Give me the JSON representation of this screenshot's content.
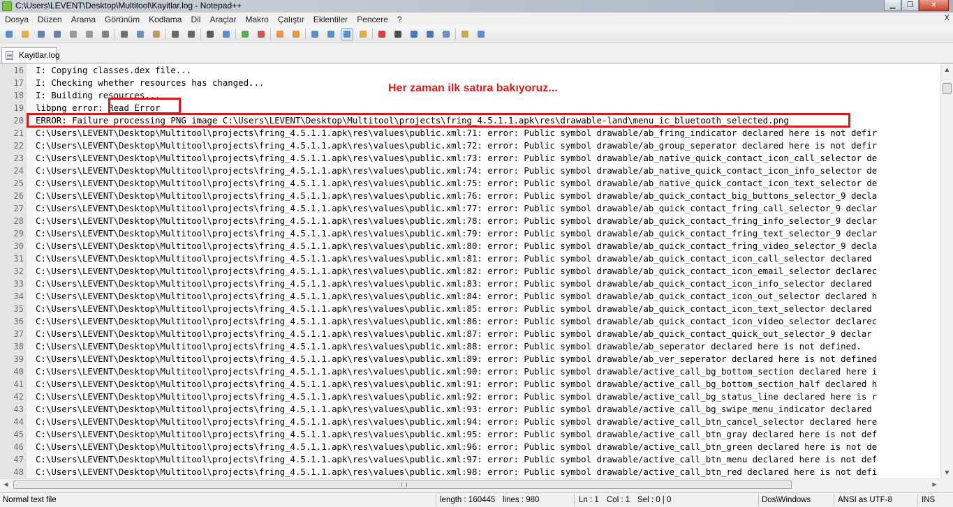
{
  "window": {
    "title": "C:\\Users\\LEVENT\\Desktop\\Multitool\\Kayitlar.log - Notepad++",
    "minimize": "▁",
    "maximize": "❐",
    "close": "✕"
  },
  "menu": {
    "items": [
      "Dosya",
      "Düzen",
      "Arama",
      "Görünüm",
      "Kodlama",
      "Dil",
      "Araçlar",
      "Makro",
      "Çalıştır",
      "Eklentiler",
      "Pencere",
      "?"
    ],
    "close_x": "X"
  },
  "toolbar": {
    "buttons": [
      {
        "name": "new-file-icon",
        "color": "#3f7fbf"
      },
      {
        "name": "open-file-icon",
        "color": "#e0a030"
      },
      {
        "name": "save-icon",
        "color": "#4a6fa5"
      },
      {
        "name": "save-all-icon",
        "color": "#4a6fa5"
      },
      {
        "name": "close-file-icon",
        "color": "#8a8a8a"
      },
      {
        "name": "close-all-icon",
        "color": "#8a8a8a"
      },
      {
        "name": "print-icon",
        "color": "#707070"
      },
      {
        "name": "cut-icon",
        "color": "#5a5a5a"
      },
      {
        "name": "copy-icon",
        "color": "#5a7fb0"
      },
      {
        "name": "paste-icon",
        "color": "#b08a4a"
      },
      {
        "name": "undo-icon",
        "color": "#505050"
      },
      {
        "name": "redo-icon",
        "color": "#505050"
      },
      {
        "name": "find-icon",
        "color": "#404040"
      },
      {
        "name": "replace-icon",
        "color": "#3f7fbf"
      },
      {
        "name": "zoom-in-icon",
        "color": "#3f9f3f"
      },
      {
        "name": "zoom-out-icon",
        "color": "#c04040"
      },
      {
        "name": "sync-vertical-icon",
        "color": "#e08a2a"
      },
      {
        "name": "sync-horizontal-icon",
        "color": "#e08a2a"
      },
      {
        "name": "word-wrap-icon",
        "color": "#3f7fbf"
      },
      {
        "name": "show-all-chars-icon",
        "color": "#3f7fbf"
      },
      {
        "name": "indent-guide-icon",
        "color": "#3f7fbf"
      },
      {
        "name": "user-lang-icon",
        "color": "#e0a030"
      },
      {
        "name": "record-macro-icon",
        "color": "#d02020"
      },
      {
        "name": "stop-record-icon",
        "color": "#303030"
      },
      {
        "name": "play-macro-icon",
        "color": "#3060b0"
      },
      {
        "name": "play-multiple-icon",
        "color": "#3060b0"
      },
      {
        "name": "save-macro-icon",
        "color": "#5a7fb0"
      },
      {
        "name": "launch-browser-icon",
        "color": "#c0a030"
      },
      {
        "name": "spell-check-icon",
        "color": "#3f7fbf"
      }
    ]
  },
  "tabs": [
    {
      "label": "Kayitlar.log"
    }
  ],
  "editor": {
    "annotation": "Her zaman ilk satıra bakıyoruz...",
    "lines": [
      {
        "num": "16",
        "text": "I: Copying classes.dex file..."
      },
      {
        "num": "17",
        "text": "I: Checking whether resources has changed..."
      },
      {
        "num": "18",
        "text": "I: Building resources..."
      },
      {
        "num": "19",
        "text": "libpng error: Read Error"
      },
      {
        "num": "20",
        "text": "ERROR: Failure processing PNG image C:\\Users\\LEVENT\\Desktop\\Multitool\\projects\\fring_4.5.1.1.apk\\res\\drawable-land\\menu_ic_bluetooth_selected.png"
      },
      {
        "num": "21",
        "text": "C:\\Users\\LEVENT\\Desktop\\Multitool\\projects\\fring_4.5.1.1.apk\\res\\values\\public.xml:71: error: Public symbol drawable/ab_fring_indicator declared here is not defir"
      },
      {
        "num": "22",
        "text": "C:\\Users\\LEVENT\\Desktop\\Multitool\\projects\\fring_4.5.1.1.apk\\res\\values\\public.xml:72: error: Public symbol drawable/ab_group_seperator declared here is not defir"
      },
      {
        "num": "23",
        "text": "C:\\Users\\LEVENT\\Desktop\\Multitool\\projects\\fring_4.5.1.1.apk\\res\\values\\public.xml:73: error: Public symbol drawable/ab_native_quick_contact_icon_call_selector de"
      },
      {
        "num": "24",
        "text": "C:\\Users\\LEVENT\\Desktop\\Multitool\\projects\\fring_4.5.1.1.apk\\res\\values\\public.xml:74: error: Public symbol drawable/ab_native_quick_contact_icon_info_selector de"
      },
      {
        "num": "25",
        "text": "C:\\Users\\LEVENT\\Desktop\\Multitool\\projects\\fring_4.5.1.1.apk\\res\\values\\public.xml:75: error: Public symbol drawable/ab_native_quick_contact_icon_text_selector de"
      },
      {
        "num": "26",
        "text": "C:\\Users\\LEVENT\\Desktop\\Multitool\\projects\\fring_4.5.1.1.apk\\res\\values\\public.xml:76: error: Public symbol drawable/ab_quick_contact_big_buttons_selector_9 decla"
      },
      {
        "num": "27",
        "text": "C:\\Users\\LEVENT\\Desktop\\Multitool\\projects\\fring_4.5.1.1.apk\\res\\values\\public.xml:77: error: Public symbol drawable/ab_quick_contact_fring_call_selector_9 declar"
      },
      {
        "num": "28",
        "text": "C:\\Users\\LEVENT\\Desktop\\Multitool\\projects\\fring_4.5.1.1.apk\\res\\values\\public.xml:78: error: Public symbol drawable/ab_quick_contact_fring_info_selector_9 declar"
      },
      {
        "num": "29",
        "text": "C:\\Users\\LEVENT\\Desktop\\Multitool\\projects\\fring_4.5.1.1.apk\\res\\values\\public.xml:79: error: Public symbol drawable/ab_quick_contact_fring_text_selector_9 declar"
      },
      {
        "num": "30",
        "text": "C:\\Users\\LEVENT\\Desktop\\Multitool\\projects\\fring_4.5.1.1.apk\\res\\values\\public.xml:80: error: Public symbol drawable/ab_quick_contact_fring_video_selector_9 decla"
      },
      {
        "num": "31",
        "text": "C:\\Users\\LEVENT\\Desktop\\Multitool\\projects\\fring_4.5.1.1.apk\\res\\values\\public.xml:81: error: Public symbol drawable/ab_quick_contact_icon_call_selector declared"
      },
      {
        "num": "32",
        "text": "C:\\Users\\LEVENT\\Desktop\\Multitool\\projects\\fring_4.5.1.1.apk\\res\\values\\public.xml:82: error: Public symbol drawable/ab_quick_contact_icon_email_selector declarec"
      },
      {
        "num": "33",
        "text": "C:\\Users\\LEVENT\\Desktop\\Multitool\\projects\\fring_4.5.1.1.apk\\res\\values\\public.xml:83: error: Public symbol drawable/ab_quick_contact_icon_info_selector declared"
      },
      {
        "num": "34",
        "text": "C:\\Users\\LEVENT\\Desktop\\Multitool\\projects\\fring_4.5.1.1.apk\\res\\values\\public.xml:84: error: Public symbol drawable/ab_quick_contact_icon_out_selector declared h"
      },
      {
        "num": "35",
        "text": "C:\\Users\\LEVENT\\Desktop\\Multitool\\projects\\fring_4.5.1.1.apk\\res\\values\\public.xml:85: error: Public symbol drawable/ab_quick_contact_icon_text_selector declared"
      },
      {
        "num": "36",
        "text": "C:\\Users\\LEVENT\\Desktop\\Multitool\\projects\\fring_4.5.1.1.apk\\res\\values\\public.xml:86: error: Public symbol drawable/ab_quick_contact_icon_video_selector declarec"
      },
      {
        "num": "37",
        "text": "C:\\Users\\LEVENT\\Desktop\\Multitool\\projects\\fring_4.5.1.1.apk\\res\\values\\public.xml:87: error: Public symbol drawable/ab_quick_contact_quick_out_selector_9 declar"
      },
      {
        "num": "38",
        "text": "C:\\Users\\LEVENT\\Desktop\\Multitool\\projects\\fring_4.5.1.1.apk\\res\\values\\public.xml:88: error: Public symbol drawable/ab_seperator declared here is not defined."
      },
      {
        "num": "39",
        "text": "C:\\Users\\LEVENT\\Desktop\\Multitool\\projects\\fring_4.5.1.1.apk\\res\\values\\public.xml:89: error: Public symbol drawable/ab_ver_seperator declared here is not defined"
      },
      {
        "num": "40",
        "text": "C:\\Users\\LEVENT\\Desktop\\Multitool\\projects\\fring_4.5.1.1.apk\\res\\values\\public.xml:90: error: Public symbol drawable/active_call_bg_bottom_section declared here i"
      },
      {
        "num": "41",
        "text": "C:\\Users\\LEVENT\\Desktop\\Multitool\\projects\\fring_4.5.1.1.apk\\res\\values\\public.xml:91: error: Public symbol drawable/active_call_bg_bottom_section_half declared h"
      },
      {
        "num": "42",
        "text": "C:\\Users\\LEVENT\\Desktop\\Multitool\\projects\\fring_4.5.1.1.apk\\res\\values\\public.xml:92: error: Public symbol drawable/active_call_bg_status_line declared here is r"
      },
      {
        "num": "43",
        "text": "C:\\Users\\LEVENT\\Desktop\\Multitool\\projects\\fring_4.5.1.1.apk\\res\\values\\public.xml:93: error: Public symbol drawable/active_call_bg_swipe_menu_indicator declared"
      },
      {
        "num": "44",
        "text": "C:\\Users\\LEVENT\\Desktop\\Multitool\\projects\\fring_4.5.1.1.apk\\res\\values\\public.xml:94: error: Public symbol drawable/active_call_btn_cancel_selector declared here"
      },
      {
        "num": "45",
        "text": "C:\\Users\\LEVENT\\Desktop\\Multitool\\projects\\fring_4.5.1.1.apk\\res\\values\\public.xml:95: error: Public symbol drawable/active_call_btn_gray declared here is not def"
      },
      {
        "num": "46",
        "text": "C:\\Users\\LEVENT\\Desktop\\Multitool\\projects\\fring_4.5.1.1.apk\\res\\values\\public.xml:96: error: Public symbol drawable/active_call_btn_green declared here is not de"
      },
      {
        "num": "47",
        "text": "C:\\Users\\LEVENT\\Desktop\\Multitool\\projects\\fring_4.5.1.1.apk\\res\\values\\public.xml:97: error: Public symbol drawable/active_call_btn_menu declared here is not def"
      },
      {
        "num": "48",
        "text": "C:\\Users\\LEVENT\\Desktop\\Multitool\\projects\\fring_4.5.1.1.apk\\res\\values\\public.xml:98: error: Public symbol drawable/active_call_btn_red declared here is not defi"
      }
    ]
  },
  "scrollbar": {
    "up": "▲",
    "down": "▼",
    "left": "◀",
    "right": "▶"
  },
  "statusbar": {
    "file_type": "Normal text file",
    "length": "length : 160445",
    "lines": "lines : 980",
    "ln": "Ln : 1",
    "col": "Col : 1",
    "sel": "Sel : 0 | 0",
    "eol": "Dos\\Windows",
    "encoding": "ANSI as UTF-8",
    "mode": "INS"
  }
}
